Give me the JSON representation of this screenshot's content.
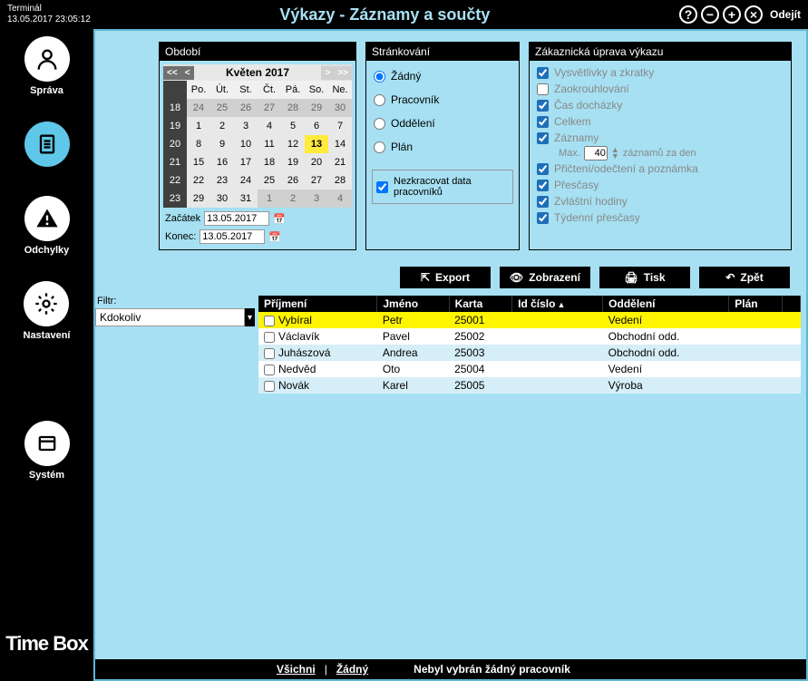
{
  "titlebar": {
    "terminal": "Terminál",
    "datetime": "13.05.2017 23:05:12",
    "title": "Výkazy - Záznamy a součty",
    "exit": "Odejít"
  },
  "sidebar": {
    "items": [
      {
        "label": "Správa"
      },
      {
        "label": ""
      },
      {
        "label": "Odchylky"
      },
      {
        "label": "Nastavení"
      },
      {
        "label": "Systém"
      }
    ],
    "brand": "Time Box"
  },
  "period": {
    "header": "Období",
    "month": "Květen 2017",
    "dow": [
      "Po.",
      "Út.",
      "St.",
      "Čt.",
      "Pá.",
      "So.",
      "Ne."
    ],
    "weeks": [
      {
        "wk": "18",
        "days": [
          {
            "d": "24",
            "c": "prev"
          },
          {
            "d": "25",
            "c": "prev"
          },
          {
            "d": "26",
            "c": "prev"
          },
          {
            "d": "27",
            "c": "prev"
          },
          {
            "d": "28",
            "c": "prev"
          },
          {
            "d": "29",
            "c": "prev"
          },
          {
            "d": "30",
            "c": "prev"
          }
        ]
      },
      {
        "wk": "19",
        "days": [
          {
            "d": "1",
            "c": "cur"
          },
          {
            "d": "2",
            "c": "cur"
          },
          {
            "d": "3",
            "c": "cur"
          },
          {
            "d": "4",
            "c": "cur"
          },
          {
            "d": "5",
            "c": "cur"
          },
          {
            "d": "6",
            "c": "cur"
          },
          {
            "d": "7",
            "c": "cur"
          }
        ]
      },
      {
        "wk": "20",
        "days": [
          {
            "d": "8",
            "c": "cur"
          },
          {
            "d": "9",
            "c": "cur"
          },
          {
            "d": "10",
            "c": "cur"
          },
          {
            "d": "11",
            "c": "cur"
          },
          {
            "d": "12",
            "c": "cur"
          },
          {
            "d": "13",
            "c": "today"
          },
          {
            "d": "14",
            "c": "cur"
          }
        ]
      },
      {
        "wk": "21",
        "days": [
          {
            "d": "15",
            "c": "cur"
          },
          {
            "d": "16",
            "c": "cur"
          },
          {
            "d": "17",
            "c": "cur"
          },
          {
            "d": "18",
            "c": "cur"
          },
          {
            "d": "19",
            "c": "cur"
          },
          {
            "d": "20",
            "c": "cur"
          },
          {
            "d": "21",
            "c": "cur"
          }
        ]
      },
      {
        "wk": "22",
        "days": [
          {
            "d": "22",
            "c": "cur"
          },
          {
            "d": "23",
            "c": "cur"
          },
          {
            "d": "24",
            "c": "cur"
          },
          {
            "d": "25",
            "c": "cur"
          },
          {
            "d": "26",
            "c": "cur"
          },
          {
            "d": "27",
            "c": "cur"
          },
          {
            "d": "28",
            "c": "cur"
          }
        ]
      },
      {
        "wk": "23",
        "days": [
          {
            "d": "29",
            "c": "cur"
          },
          {
            "d": "30",
            "c": "cur"
          },
          {
            "d": "31",
            "c": "cur"
          },
          {
            "d": "1",
            "c": "next"
          },
          {
            "d": "2",
            "c": "next"
          },
          {
            "d": "3",
            "c": "next"
          },
          {
            "d": "4",
            "c": "next"
          }
        ]
      }
    ],
    "start_label": "Začátek",
    "start_value": "13.05.2017",
    "end_label": "Konec:",
    "end_value": "13.05.2017"
  },
  "paging": {
    "header": "Stránkování",
    "options": [
      "Žádný",
      "Pracovník",
      "Oddělení",
      "Plán"
    ],
    "selected": 0,
    "noshorten": "Nezkracovat data pracovníků"
  },
  "customize": {
    "header": "Zákaznická úprava výkazu",
    "items": [
      "Vysvětlivky a zkratky",
      "Zaokrouhlování",
      "Čas docházky",
      "Celkem",
      "Záznamy",
      "Přičtení/odečtení a poznámka",
      "Přesčasy",
      "Zvláštní hodiny",
      "Týdenní přesčasy"
    ],
    "max_prefix": "Max.",
    "max_value": "40",
    "max_suffix": "záznamů za den"
  },
  "actions": {
    "export": "Export",
    "view": "Zobrazení",
    "print": "Tisk",
    "back": "Zpět"
  },
  "filter": {
    "label": "Filtr:",
    "value": "Kdokoliv"
  },
  "grid": {
    "columns": [
      "Příjmení",
      "Jméno",
      "Karta",
      "Id číslo",
      "Oddělení",
      "Plán",
      ""
    ],
    "rows": [
      {
        "surname": "Vybíral",
        "name": "Petr",
        "card": "25001",
        "id": "",
        "dept": "Vedení",
        "plan": ""
      },
      {
        "surname": "Václavík",
        "name": "Pavel",
        "card": "25002",
        "id": "",
        "dept": "Obchodní odd.",
        "plan": ""
      },
      {
        "surname": "Juhászová",
        "name": "Andrea",
        "card": "25003",
        "id": "",
        "dept": "Obchodní odd.",
        "plan": ""
      },
      {
        "surname": "Nedvěd",
        "name": "Oto",
        "card": "25004",
        "id": "",
        "dept": "Vedení",
        "plan": ""
      },
      {
        "surname": "Novák",
        "name": "Karel",
        "card": "25005",
        "id": "",
        "dept": "Výroba",
        "plan": ""
      }
    ]
  },
  "statusbar": {
    "all": "Všichni",
    "none": "Žádný",
    "msg": "Nebyl vybrán žádný pracovník"
  }
}
